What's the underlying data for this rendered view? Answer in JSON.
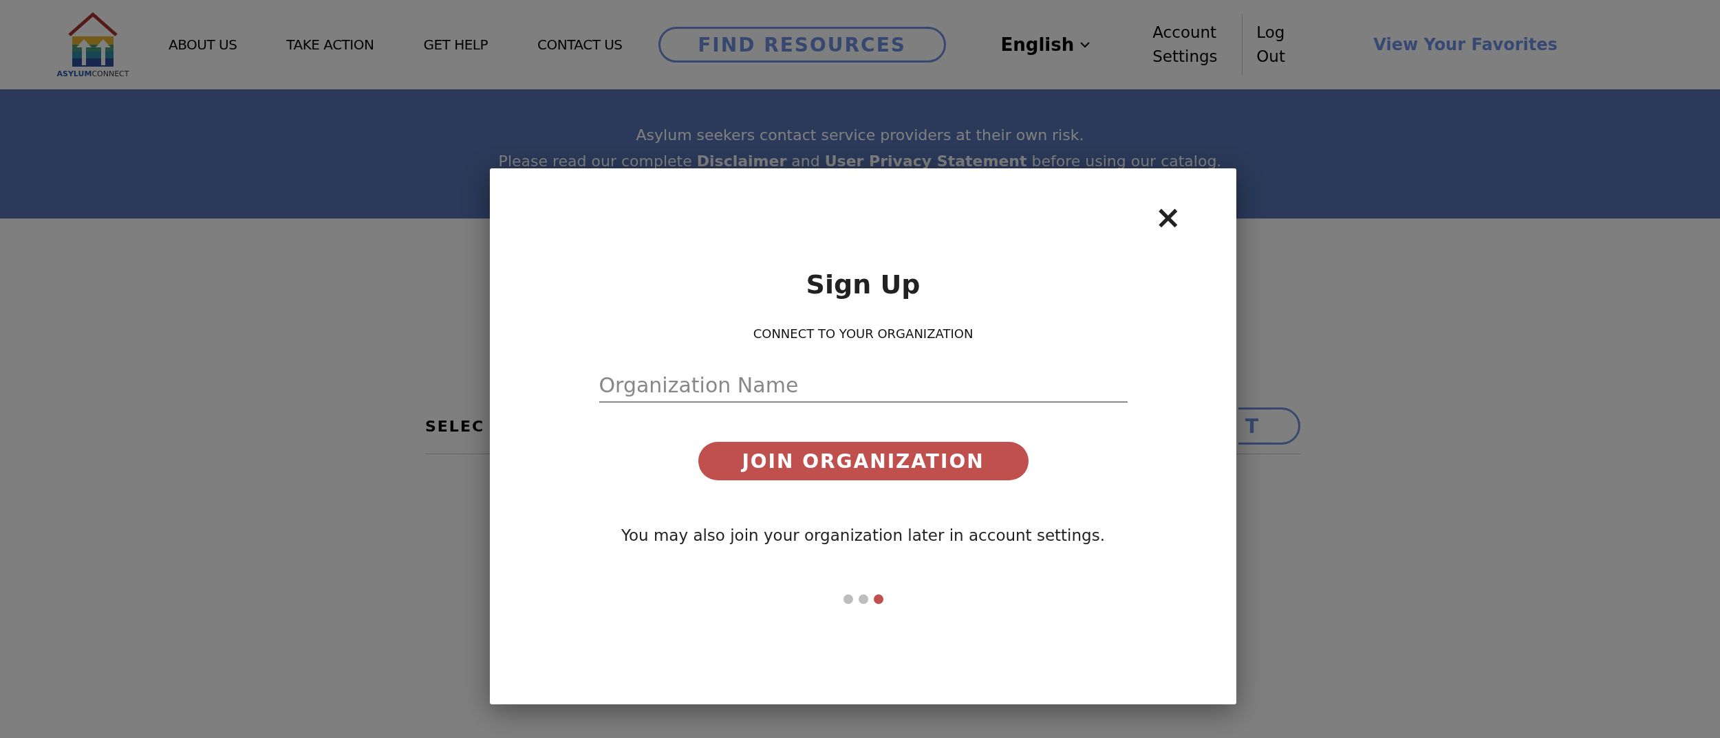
{
  "header": {
    "logo_text": "**ASYLUM**CONNECT",
    "nav": [
      "ABOUT US",
      "TAKE ACTION",
      "GET HELP",
      "CONTACT US"
    ],
    "find_button": "FIND RESOURCES",
    "language": "English",
    "account": "Account Settings",
    "logout": "Log Out",
    "favorites": "View Your Favorites"
  },
  "banner": {
    "lines": [
      "Asylum seekers contact service providers at their own risk.",
      "Please read our complete **Disclaimer** and **User Privacy Statement** before using our catalog."
    ]
  },
  "background": {
    "heading": "SELEC",
    "button": "T"
  },
  "modal": {
    "close": "×",
    "title": "Sign Up",
    "subtitle": "CONNECT TO YOUR ORGANIZATION",
    "field": {
      "placeholder": "Organization Name"
    },
    "button": "JOIN ORGANIZATION",
    "note": "You may also join your organization later in account settings.",
    "steps": [
      {
        "selected": false
      },
      {
        "selected": false
      },
      {
        "selected": true
      }
    ]
  }
}
